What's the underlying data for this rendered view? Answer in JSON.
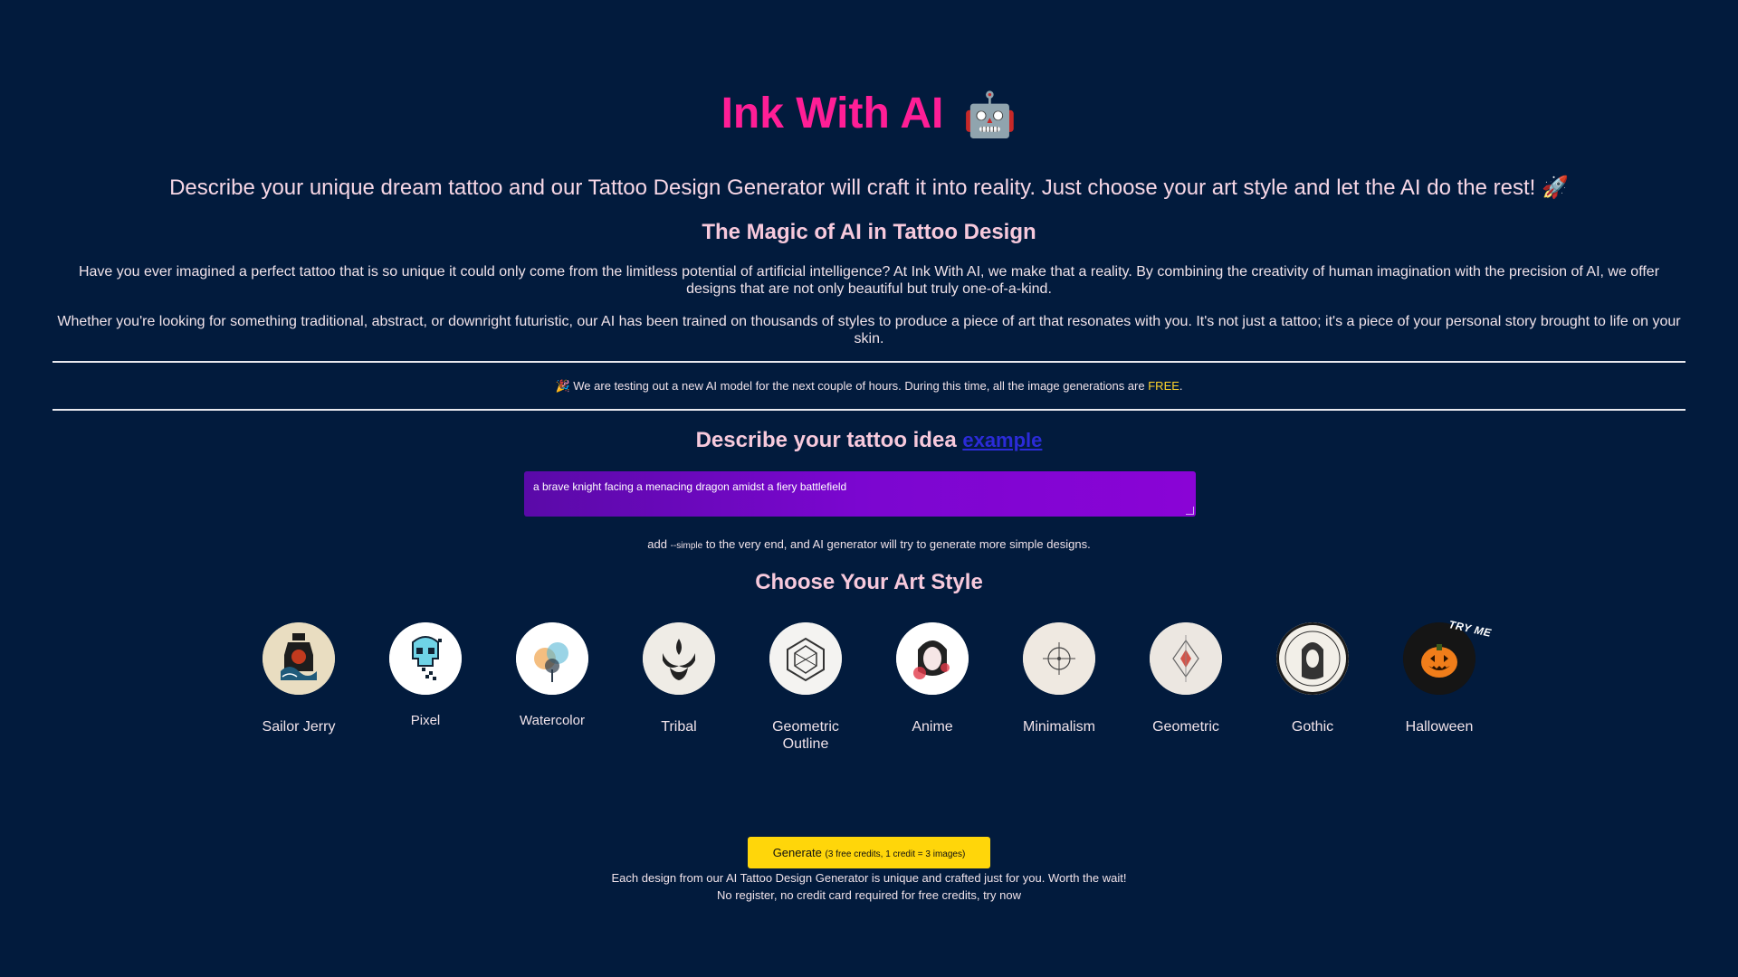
{
  "header": {
    "title": "Ink With AI",
    "title_emoji": "🤖",
    "tagline": "Describe your unique dream tattoo and our Tattoo Design Generator will craft it into reality. Just choose your art style and let the AI do the rest! 🚀"
  },
  "magic": {
    "heading": "The Magic of AI in Tattoo Design",
    "paragraph1": "Have you ever imagined a perfect tattoo that is so unique it could only come from the limitless potential of artificial intelligence? At Ink With AI, we make that a reality. By combining the creativity of human imagination with the precision of AI, we offer designs that are not only beautiful but truly one-of-a-kind.",
    "paragraph2": "Whether you're looking for something traditional, abstract, or downright futuristic, our AI has been trained on thousands of styles to produce a piece of art that resonates with you. It's not just a tattoo; it's a piece of your personal story brought to life on your skin."
  },
  "notice": {
    "emoji": "🎉",
    "text": "We are testing out a new AI model for the next couple of hours. During this time, all the image generations are",
    "highlight": "FREE",
    "end": ".",
    "highlight_color": "#ffd42a"
  },
  "describe": {
    "heading": "Describe your tattoo idea",
    "example_link": "example",
    "prompt_value": "a brave knight facing a menacing dragon amidst a fiery battlefield",
    "hint_prefix": "add",
    "hint_code": "--simple",
    "hint_suffix": "to the very end, and AI generator will try to generate more simple designs."
  },
  "styles": {
    "heading": "Choose Your Art Style",
    "try_me": "TRY ME",
    "items": [
      {
        "label": "Sailor Jerry",
        "icon": "sailor-jerry-icon"
      },
      {
        "label": "Pixel",
        "icon": "pixel-skull-icon"
      },
      {
        "label": "Watercolor",
        "icon": "watercolor-icon"
      },
      {
        "label": "Tribal",
        "icon": "tribal-icon"
      },
      {
        "label": "Geometric Outline",
        "icon": "geometric-outline-icon"
      },
      {
        "label": "Anime",
        "icon": "anime-icon"
      },
      {
        "label": "Minimalism",
        "icon": "minimalism-icon"
      },
      {
        "label": "Geometric",
        "icon": "geometric-icon"
      },
      {
        "label": "Gothic",
        "icon": "gothic-icon"
      },
      {
        "label": "Halloween",
        "icon": "halloween-pumpkin-icon"
      }
    ]
  },
  "generate": {
    "label": "Generate",
    "sub_label": "(3 free credits, 1 credit = 3 images)",
    "footer1": "Each design from our AI Tattoo Design Generator is unique and crafted just for you. Worth the wait!",
    "footer2": "No register, no credit card required for free credits, try now"
  },
  "colors": {
    "background": "#021b3d",
    "title": "#ff1e96",
    "accent_button": "#ffd60a",
    "prompt_gradient_start": "#5a0aa8",
    "prompt_gradient_end": "#8a04d6"
  }
}
